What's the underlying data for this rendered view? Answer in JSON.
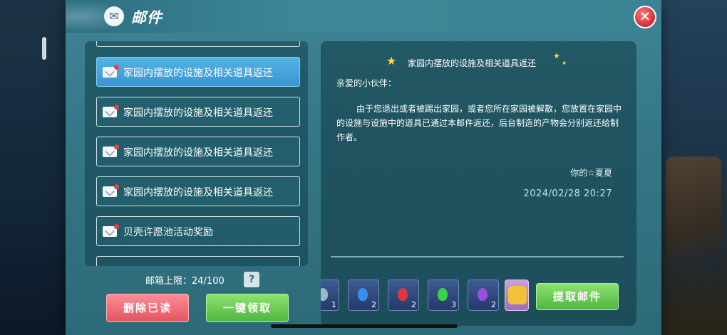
{
  "window": {
    "title": "邮件",
    "title_icon": "mailbox-icon",
    "close_icon": "close-x-icon"
  },
  "mail_list": {
    "items": [
      {
        "label": "家园内摆放的设施及相关道具返还",
        "selected": true
      },
      {
        "label": "家园内摆放的设施及相关道具返还",
        "selected": false
      },
      {
        "label": "家园内摆放的设施及相关道具返还",
        "selected": false
      },
      {
        "label": "家园内摆放的设施及相关道具返还",
        "selected": false
      },
      {
        "label": "贝壳许愿池活动奖励",
        "selected": false
      }
    ],
    "capacity_label": "邮箱上限：24/100",
    "help_label": "?"
  },
  "buttons": {
    "delete_read": "删除已读",
    "claim_all": "一键领取",
    "extract_mail": "提取邮件"
  },
  "mail_detail": {
    "title": "家园内摆放的设施及相关道具返还",
    "greeting": "亲爱的小伙伴：",
    "body": "由于您退出或者被踢出家园，或者您所在家园被解散，您放置在家园中的设施与设施中的道具已通过本邮件返还，后台制造的产物会分别返还给制作者。",
    "signature": "你的☆夏夏",
    "date": "2024/02/28 20:27"
  },
  "attachments": [
    {
      "name": "partial-item-icon",
      "qty": "1",
      "color": "#9fb6c8"
    },
    {
      "name": "blue-crystal-icon",
      "qty": "2",
      "color": "#3a8cf0"
    },
    {
      "name": "red-crystal-icon",
      "qty": "2",
      "color": "#e0363f"
    },
    {
      "name": "green-crystal-icon",
      "qty": "3",
      "color": "#3ccf4a"
    },
    {
      "name": "purple-crystal-icon",
      "qty": "2",
      "color": "#9a4ee0"
    },
    {
      "name": "gold-badge-icon",
      "qty": "",
      "color": "#f2c13a"
    }
  ],
  "colors": {
    "panel": "#3a8394",
    "selected_item": "#4aa8de",
    "delete_button": "#e8626c",
    "green_button": "#6ccb55",
    "close_button": "#d9363e"
  }
}
